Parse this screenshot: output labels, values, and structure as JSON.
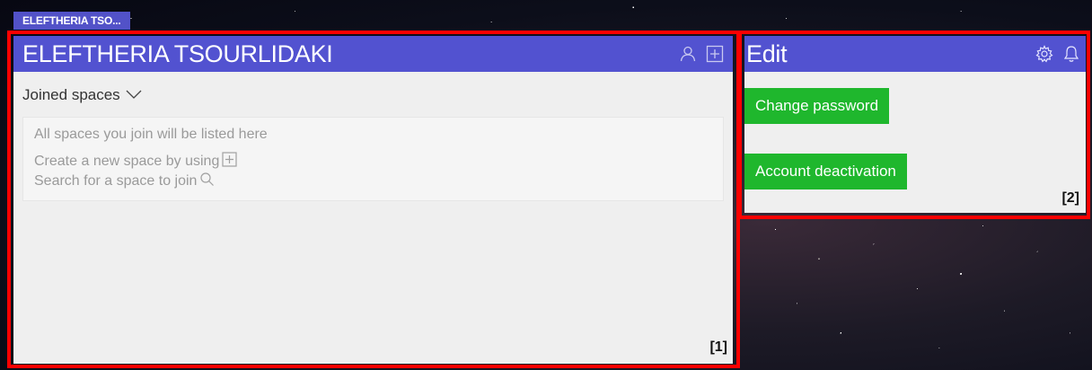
{
  "top_tab": {
    "label": "ELEFTHERIA TSO..."
  },
  "profile_panel": {
    "title": "ELEFTHERIA TSOURLIDAKI",
    "icons": [
      "user-icon",
      "plus-square-icon"
    ],
    "dropdown_label": "Joined spaces",
    "info": {
      "heading": "All spaces you join will be listed here",
      "create_text": "Create a new space by using",
      "search_text": "Search for a space to join"
    },
    "marker_label": "[1]"
  },
  "edit_panel": {
    "title": "Edit",
    "icons": [
      "gear-icon",
      "bell-icon"
    ],
    "change_password_label": "Change password",
    "account_deactivation_label": "Account deactivation",
    "marker_label": "[2]"
  },
  "colors": {
    "header": "#5252d0",
    "button": "#1fb72d",
    "marker": "#ff0000",
    "panel_bg": "#efefef"
  }
}
